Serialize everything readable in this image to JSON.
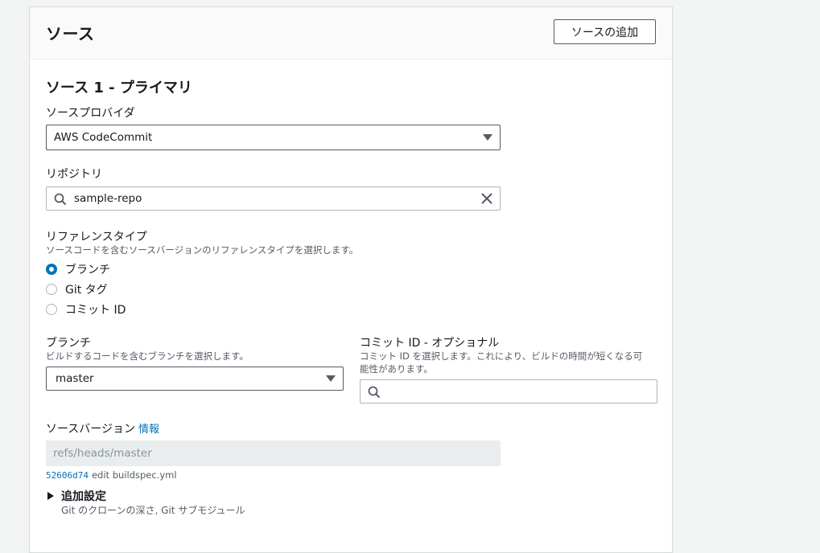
{
  "panel": {
    "title": "ソース",
    "add_source_label": "ソースの追加"
  },
  "source1": {
    "title": "ソース 1 - プライマリ",
    "provider": {
      "label": "ソースプロバイダ",
      "value": "AWS CodeCommit"
    },
    "repository": {
      "label": "リポジトリ",
      "value": "sample-repo"
    },
    "reference_type": {
      "label": "リファレンスタイプ",
      "description": "ソースコードを含むソースバージョンのリファレンスタイプを選択します。",
      "options": [
        {
          "label": "ブランチ",
          "checked": true
        },
        {
          "label": "Git タグ",
          "checked": false
        },
        {
          "label": "コミット ID",
          "checked": false
        }
      ]
    },
    "branch": {
      "label": "ブランチ",
      "description": "ビルドするコードを含むブランチを選択します。",
      "value": "master"
    },
    "commit_id": {
      "label": "コミット ID - オプショナル",
      "description_line1": "コミット ID を選択します。これにより、ビルドの時間が短くなる可",
      "description_line2": "能性があります。",
      "value": ""
    },
    "source_version": {
      "label": "ソースバージョン",
      "info_link": "情報",
      "value": "refs/heads/master",
      "commit_hash": "52606d74",
      "commit_message": "edit buildspec.yml"
    },
    "additional": {
      "label": "追加設定",
      "description": "Git のクローンの深さ, Git サブモジュール"
    }
  },
  "colors": {
    "accent": "#0073bb",
    "border": "#545b64",
    "disabled_bg": "#eaeded"
  }
}
